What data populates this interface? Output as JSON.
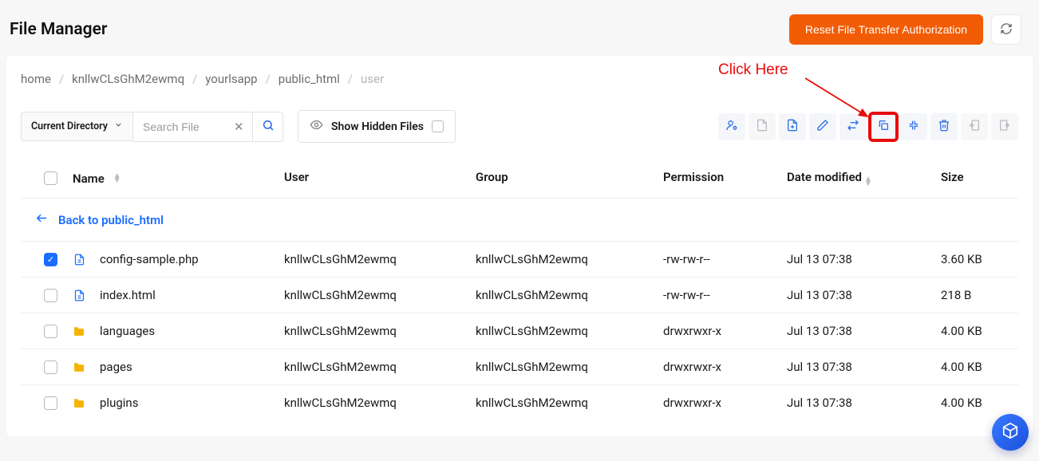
{
  "header": {
    "title": "File Manager",
    "reset_label": "Reset File Transfer Authorization"
  },
  "breadcrumbs": [
    {
      "label": "home"
    },
    {
      "label": "knllwCLsGhM2ewmq"
    },
    {
      "label": "yourlsapp"
    },
    {
      "label": "public_html"
    },
    {
      "label": "user",
      "current": true
    }
  ],
  "search": {
    "selector_label": "Current Directory",
    "placeholder": "Search File"
  },
  "hidden": {
    "label": "Show Hidden Files"
  },
  "action_icons": [
    "user-settings",
    "new-file",
    "new-folder",
    "edit",
    "swap",
    "copy",
    "compress",
    "delete",
    "move-left",
    "move-right"
  ],
  "highlight_action": "copy",
  "columns": {
    "name": "Name",
    "user": "User",
    "group": "Group",
    "permission": "Permission",
    "date": "Date modified",
    "size": "Size"
  },
  "back_link": "Back to public_html",
  "annotation_text": "Click Here",
  "rows": [
    {
      "icon": "doc",
      "name": "config-sample.php",
      "user": "knllwCLsGhM2ewmq",
      "group": "knllwCLsGhM2ewmq",
      "perm": "-rw-rw-r--",
      "date": "Jul 13 07:38",
      "size": "3.60 KB",
      "checked": true
    },
    {
      "icon": "doc",
      "name": "index.html",
      "user": "knllwCLsGhM2ewmq",
      "group": "knllwCLsGhM2ewmq",
      "perm": "-rw-rw-r--",
      "date": "Jul 13 07:38",
      "size": "218 B",
      "checked": false
    },
    {
      "icon": "folder",
      "name": "languages",
      "user": "knllwCLsGhM2ewmq",
      "group": "knllwCLsGhM2ewmq",
      "perm": "drwxrwxr-x",
      "date": "Jul 13 07:38",
      "size": "4.00 KB",
      "checked": false
    },
    {
      "icon": "folder",
      "name": "pages",
      "user": "knllwCLsGhM2ewmq",
      "group": "knllwCLsGhM2ewmq",
      "perm": "drwxrwxr-x",
      "date": "Jul 13 07:38",
      "size": "4.00 KB",
      "checked": false
    },
    {
      "icon": "folder",
      "name": "plugins",
      "user": "knllwCLsGhM2ewmq",
      "group": "knllwCLsGhM2ewmq",
      "perm": "drwxrwxr-x",
      "date": "Jul 13 07:38",
      "size": "4.00 KB",
      "checked": false
    }
  ]
}
